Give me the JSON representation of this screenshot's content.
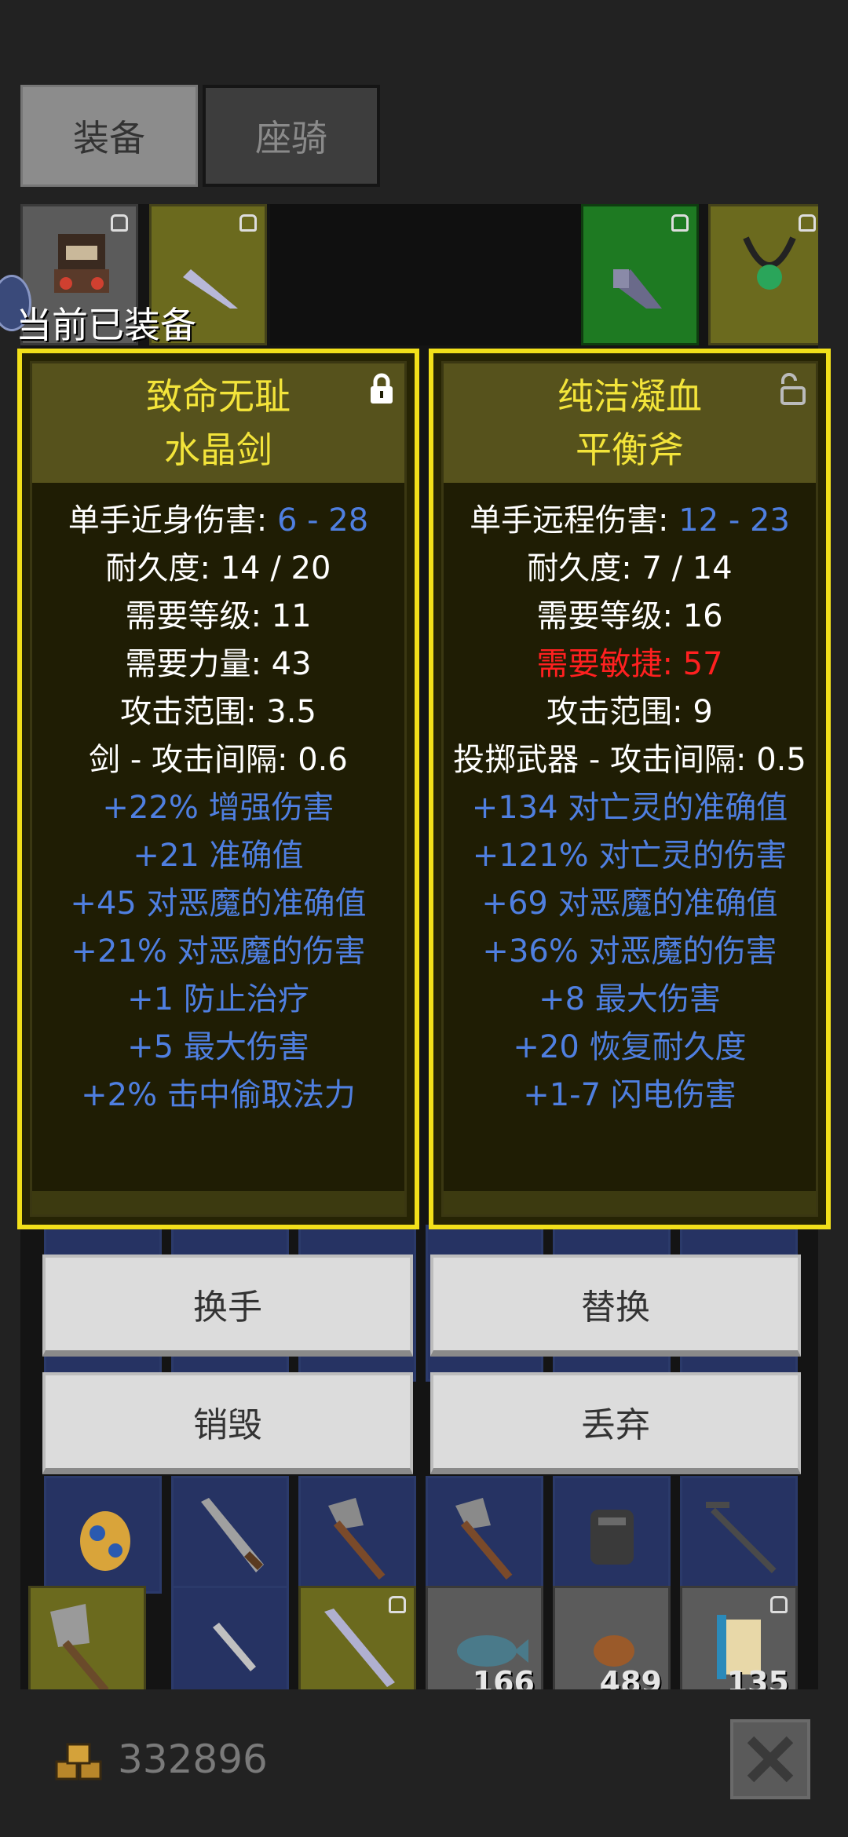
{
  "tabs": {
    "equipment": "装备",
    "mount": "座骑"
  },
  "equipped_label": "当前已装备",
  "panel_left": {
    "name_line1": "致命无耻",
    "name_line2": "水晶剑",
    "damage_label": "单手近身伤害: ",
    "damage_value": "6 - 28",
    "durability": "耐久度: 14 / 20",
    "req_level": "需要等级: 11",
    "req_attr": "需要力量: 43",
    "range": "攻击范围: 3.5",
    "speed": "剑 - 攻击间隔: 0.6",
    "mods": [
      "+22% 增强伤害",
      "+21 准确值",
      "+45 对恶魔的准确值",
      "+21% 对恶魔的伤害",
      "+1 防止治疗",
      "+5 最大伤害",
      "+2% 击中偷取法力"
    ],
    "locked": true
  },
  "panel_right": {
    "name_line1": "纯洁凝血",
    "name_line2": "平衡斧",
    "damage_label": "单手远程伤害: ",
    "damage_value": "12 - 23",
    "durability": "耐久度: 7 / 14",
    "req_level": "需要等级: 16",
    "req_attr": "需要敏捷: 57",
    "range": "攻击范围: 9",
    "speed": "投掷武器 - 攻击间隔: 0.5",
    "mods": [
      "+134 对亡灵的准确值",
      "+121% 对亡灵的伤害",
      "+69 对恶魔的准确值",
      "+36% 对恶魔的伤害",
      "+8 最大伤害",
      "+20 恢复耐久度",
      "+1-7 闪电伤害"
    ],
    "locked": false
  },
  "buttons": {
    "swap_hand": "换手",
    "replace": "替换",
    "destroy": "销毁",
    "discard": "丢弃"
  },
  "inventory_counts": {
    "fish": "166",
    "meat": "489",
    "scroll": "135"
  },
  "gold": "332896",
  "colors": {
    "panel_border": "#f2e01a",
    "name_text": "#f3e43a",
    "mod_text": "#4f7fe0",
    "unmet_req": "#ff2020"
  }
}
